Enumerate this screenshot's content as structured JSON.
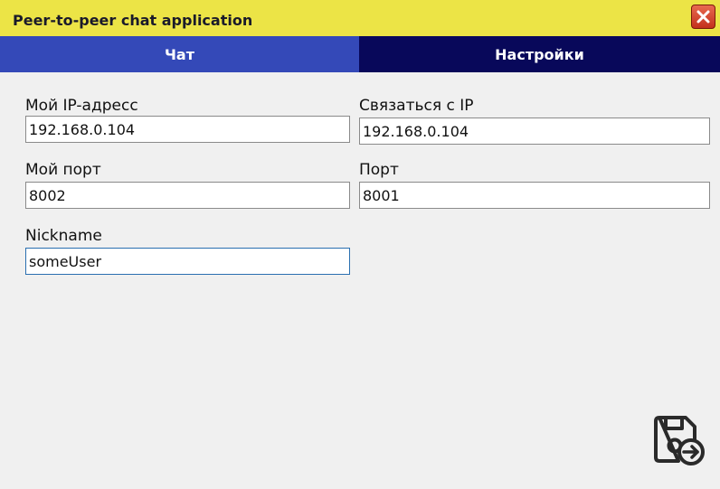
{
  "window": {
    "title": "Peer-to-peer chat application",
    "close_icon": "close-icon"
  },
  "tabs": [
    {
      "label": "Чат",
      "active": false
    },
    {
      "label": "Настройки",
      "active": true
    }
  ],
  "settings": {
    "my_ip": {
      "label": "Мой IP-адресс",
      "value": "192.168.0.104"
    },
    "connect_ip": {
      "label": "Связаться с IP",
      "value": "192.168.0.104"
    },
    "my_port": {
      "label": "Мой порт",
      "value": "8002"
    },
    "port": {
      "label": "Порт",
      "value": "8001"
    },
    "nickname": {
      "label": "Nickname",
      "value": "someUser"
    }
  },
  "actions": {
    "save_icon": "save-icon"
  },
  "colors": {
    "titlebar": "#ece446",
    "tab_chat": "#3449b8",
    "tab_settings_active": "#08085a",
    "close_button": "#d4422a",
    "focus_border": "#2a6fb0"
  }
}
